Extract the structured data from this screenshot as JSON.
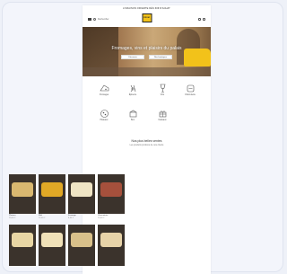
{
  "promo": {
    "text": "LIVRAISON OFFERTE DÈS 60€ D'ACHAT"
  },
  "header": {
    "search_label": "Rechercher",
    "logo_text": "FROM"
  },
  "hero": {
    "title": "Fromages, vins et plaisirs du palais",
    "buttons": [
      "Découvrir",
      "Nos boutiques"
    ]
  },
  "categories": [
    {
      "label": "Fromages",
      "icon": "cheese-icon"
    },
    {
      "label": "Épicerie",
      "icon": "grocery-icon"
    },
    {
      "label": "Vins",
      "icon": "wine-icon"
    },
    {
      "label": "Charcuterie",
      "icon": "charcuterie-icon"
    },
    {
      "label": "Plateaux",
      "icon": "platter-icon"
    },
    {
      "label": "Box",
      "icon": "box-icon"
    },
    {
      "label": "Cadeaux",
      "icon": "gift-icon"
    }
  ],
  "section": {
    "title": "Nos plus belles ventes",
    "subtitle": "Les produits préférés de nos clients"
  },
  "products": [
    {
      "name": "Plateau",
      "price": "29,00 €",
      "color": "#d9b870"
    },
    {
      "name": "Miel",
      "price": "12,00 €",
      "color": "#e0a826"
    },
    {
      "name": "Fromage",
      "price": "8,50 €",
      "color": "#efe4c4"
    },
    {
      "name": "Charcuterie",
      "price": "15,00 €",
      "color": "#a5503c"
    },
    {
      "name": "",
      "price": "",
      "color": "#e8d6a4"
    },
    {
      "name": "",
      "price": "",
      "color": "#f0e1b8"
    },
    {
      "name": "",
      "price": "",
      "color": "#d8c08a"
    },
    {
      "name": "",
      "price": "",
      "color": "#e7d3a8"
    }
  ]
}
